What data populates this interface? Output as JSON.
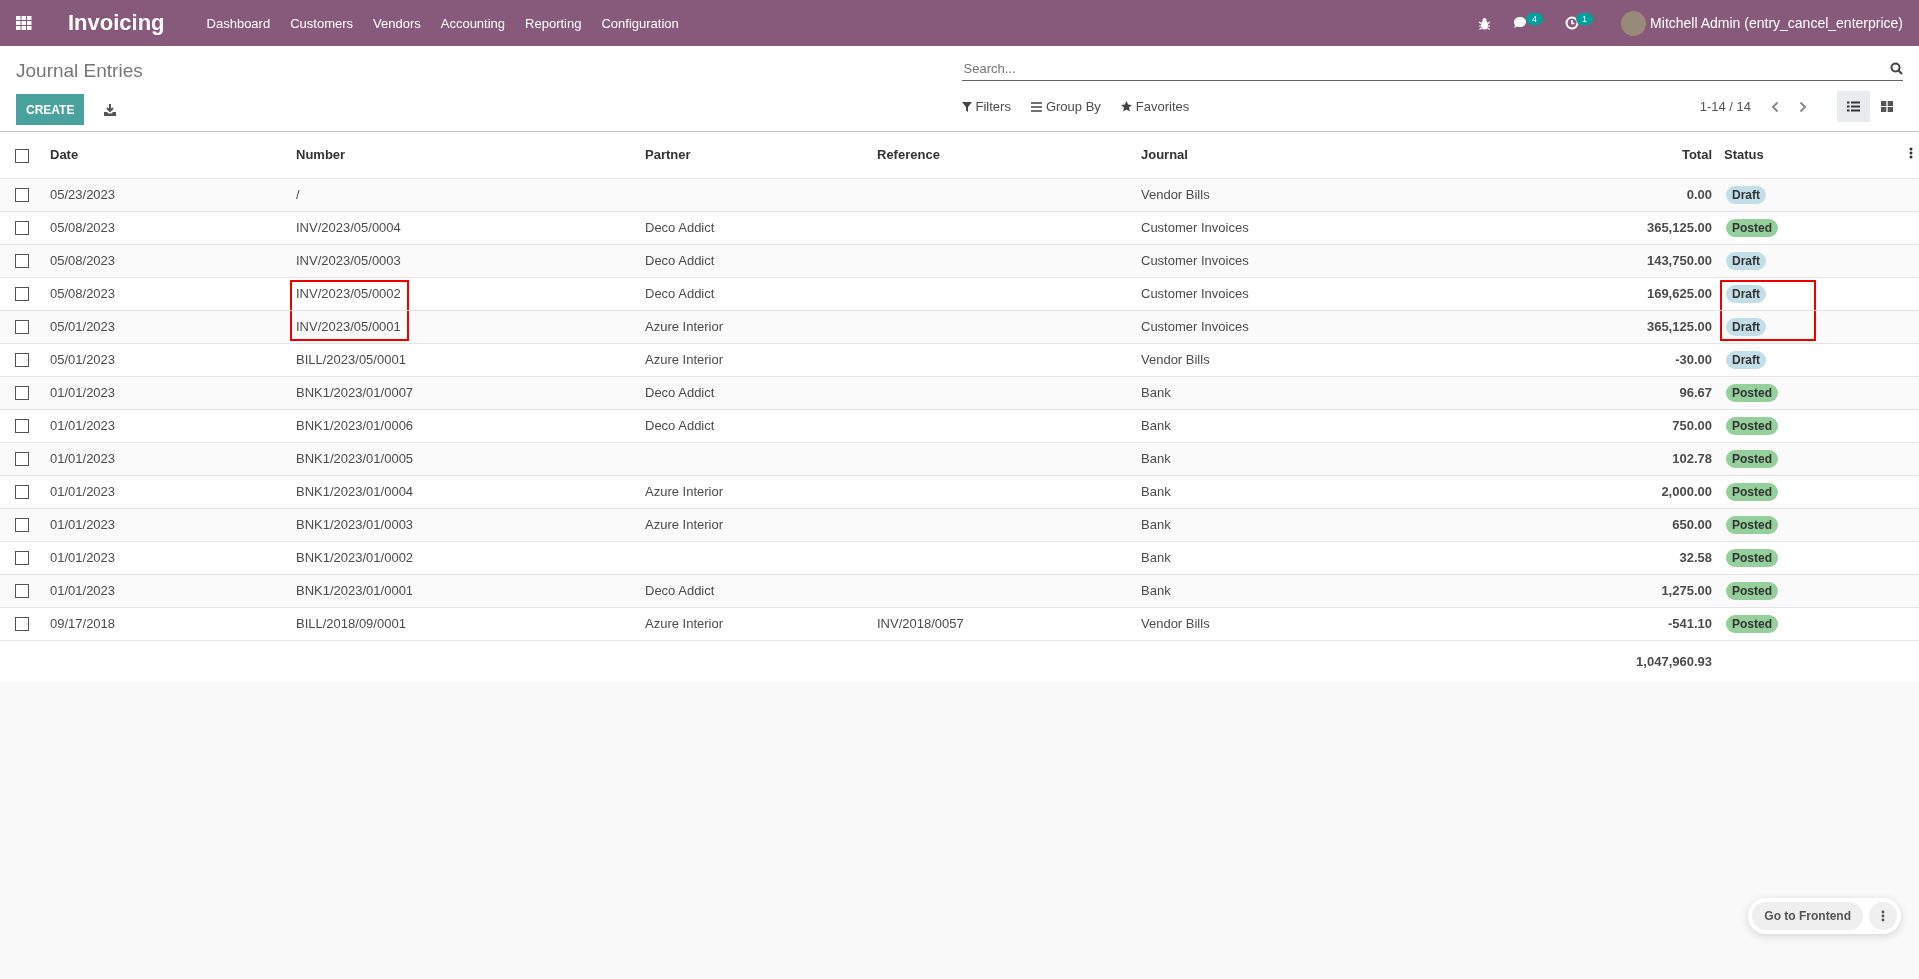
{
  "navbar": {
    "app_name": "Invoicing",
    "menu": [
      "Dashboard",
      "Customers",
      "Vendors",
      "Accounting",
      "Reporting",
      "Configuration"
    ],
    "messages_count": "4",
    "activities_count": "1",
    "user": "Mitchell Admin (entry_cancel_enterprice)"
  },
  "page": {
    "title": "Journal Entries",
    "create_label": "CREATE",
    "search": {
      "placeholder": "Search..."
    },
    "filters": [
      "Filters",
      "Group By",
      "Favorites"
    ],
    "pager": "1-14 / 14",
    "views": [
      {
        "kind": "list",
        "selected": true
      },
      {
        "kind": "kanban",
        "selected": false
      }
    ]
  },
  "table": {
    "select_all_checked": false,
    "columns": [
      "Date",
      "Number",
      "Partner",
      "Reference",
      "Journal",
      "Total",
      "Status"
    ],
    "rows": [
      {
        "date": "05/23/2023",
        "number": "/",
        "partner": "",
        "reference": "",
        "journal": "Vendor Bills",
        "total": "0.00",
        "status": "Draft",
        "kind": "draft",
        "checked": false,
        "number_marked": false,
        "status_marked": false
      },
      {
        "date": "05/08/2023",
        "number": "INV/2023/05/0004",
        "partner": "Deco Addict",
        "reference": "",
        "journal": "Customer Invoices",
        "total": "365,125.00",
        "status": "Posted",
        "kind": "posted",
        "checked": false,
        "number_marked": false,
        "status_marked": false
      },
      {
        "date": "05/08/2023",
        "number": "INV/2023/05/0003",
        "partner": "Deco Addict",
        "reference": "",
        "journal": "Customer Invoices",
        "total": "143,750.00",
        "status": "Draft",
        "kind": "draft",
        "checked": false,
        "number_marked": false,
        "status_marked": false
      },
      {
        "date": "05/08/2023",
        "number": "INV/2023/05/0002",
        "partner": "Deco Addict",
        "reference": "",
        "journal": "Customer Invoices",
        "total": "169,625.00",
        "status": "Draft",
        "kind": "draft",
        "checked": false,
        "number_marked": true,
        "status_marked": true
      },
      {
        "date": "05/01/2023",
        "number": "INV/2023/05/0001",
        "partner": "Azure Interior",
        "reference": "",
        "journal": "Customer Invoices",
        "total": "365,125.00",
        "status": "Draft",
        "kind": "draft",
        "checked": false,
        "number_marked": true,
        "status_marked": true
      },
      {
        "date": "05/01/2023",
        "number": "BILL/2023/05/0001",
        "partner": "Azure Interior",
        "reference": "",
        "journal": "Vendor Bills",
        "total": "-30.00",
        "status": "Draft",
        "kind": "draft",
        "checked": false,
        "number_marked": false,
        "status_marked": false
      },
      {
        "date": "01/01/2023",
        "number": "BNK1/2023/01/0007",
        "partner": "Deco Addict",
        "reference": "",
        "journal": "Bank",
        "total": "96.67",
        "status": "Posted",
        "kind": "posted",
        "checked": false,
        "number_marked": false,
        "status_marked": false
      },
      {
        "date": "01/01/2023",
        "number": "BNK1/2023/01/0006",
        "partner": "Deco Addict",
        "reference": "",
        "journal": "Bank",
        "total": "750.00",
        "status": "Posted",
        "kind": "posted",
        "checked": false,
        "number_marked": false,
        "status_marked": false
      },
      {
        "date": "01/01/2023",
        "number": "BNK1/2023/01/0005",
        "partner": "",
        "reference": "",
        "journal": "Bank",
        "total": "102.78",
        "status": "Posted",
        "kind": "posted",
        "checked": false,
        "number_marked": false,
        "status_marked": false
      },
      {
        "date": "01/01/2023",
        "number": "BNK1/2023/01/0004",
        "partner": "Azure Interior",
        "reference": "",
        "journal": "Bank",
        "total": "2,000.00",
        "status": "Posted",
        "kind": "posted",
        "checked": false,
        "number_marked": false,
        "status_marked": false
      },
      {
        "date": "01/01/2023",
        "number": "BNK1/2023/01/0003",
        "partner": "Azure Interior",
        "reference": "",
        "journal": "Bank",
        "total": "650.00",
        "status": "Posted",
        "kind": "posted",
        "checked": false,
        "number_marked": false,
        "status_marked": false
      },
      {
        "date": "01/01/2023",
        "number": "BNK1/2023/01/0002",
        "partner": "",
        "reference": "",
        "journal": "Bank",
        "total": "32.58",
        "status": "Posted",
        "kind": "posted",
        "checked": false,
        "number_marked": false,
        "status_marked": false
      },
      {
        "date": "01/01/2023",
        "number": "BNK1/2023/01/0001",
        "partner": "Deco Addict",
        "reference": "",
        "journal": "Bank",
        "total": "1,275.00",
        "status": "Posted",
        "kind": "posted",
        "checked": false,
        "number_marked": false,
        "status_marked": false
      },
      {
        "date": "09/17/2018",
        "number": "BILL/2018/09/0001",
        "partner": "Azure Interior",
        "reference": "INV/2018/0057",
        "journal": "Vendor Bills",
        "total": "-541.10",
        "status": "Posted",
        "kind": "posted",
        "checked": false,
        "number_marked": false,
        "status_marked": false
      }
    ],
    "grand_total": "1,047,960.93"
  },
  "frontend_button": "Go to Frontend"
}
